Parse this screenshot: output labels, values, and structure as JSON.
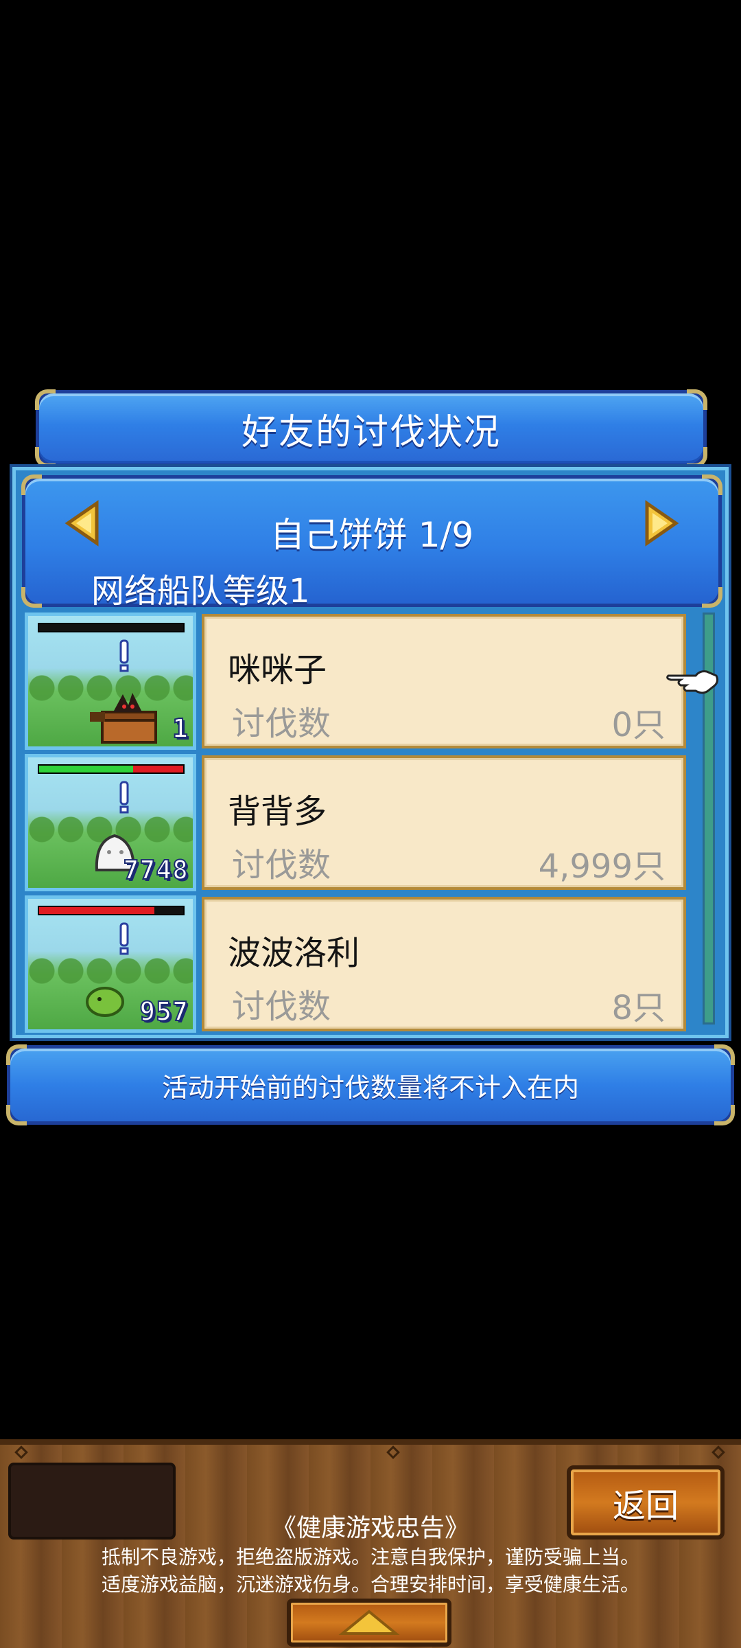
{
  "title": "好友的讨伐状况",
  "header": {
    "friend_name": "自己饼饼 1/9",
    "fleet_level": "网络船队等级1",
    "prev_icon": "arrow-left-icon",
    "next_icon": "arrow-right-icon"
  },
  "rows": [
    {
      "name": "咪咪子",
      "label": "讨伐数",
      "value": "0只",
      "portrait_count": "1",
      "hp_fraction": 0.0,
      "monster": "treasure-chest"
    },
    {
      "name": "背背多",
      "label": "讨伐数",
      "value": "4,999只",
      "portrait_count": "7748",
      "hp_fraction": 0.65,
      "monster": "white-blob"
    },
    {
      "name": "波波洛利",
      "label": "讨伐数",
      "value": "8只",
      "portrait_count": "957",
      "hp_fraction": 0.8,
      "monster": "green-blob"
    }
  ],
  "notice": "活动开始前的讨伐数量将不计入在内",
  "footer": {
    "back_label": "返回",
    "health_title": "《健康游戏忠告》",
    "health_line1": "抵制不良游戏，拒绝盗版游戏。注意自我保护，谨防受骗上当。",
    "health_line2": "适度游戏益脑，沉迷游戏伤身。合理安排时间，享受健康生活。",
    "up_icon": "triangle-up-icon"
  },
  "colors": {
    "panel_blue": "#2f7fe6",
    "card_cream": "#f8e8c8",
    "gold_trim": "#c9b46a",
    "wood_brown": "#7a4d22",
    "button_orange": "#d37a1f"
  }
}
